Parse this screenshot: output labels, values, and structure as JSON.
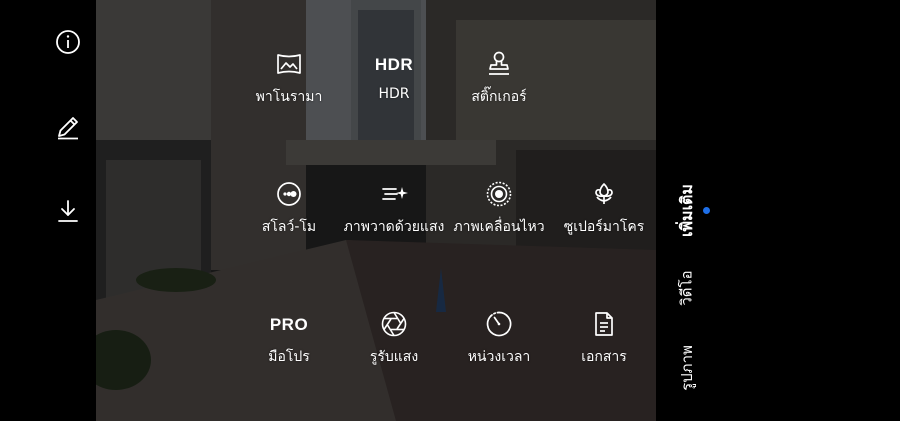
{
  "accent_color": "#1e6fe8",
  "left_controls": [
    {
      "name": "info-icon"
    },
    {
      "name": "edit-icon"
    },
    {
      "name": "download-icon"
    }
  ],
  "modes": {
    "row1": [
      {
        "icon": "panorama-icon",
        "label": "พาโนรามา"
      },
      {
        "icon_text": "HDR",
        "label": "HDR"
      },
      {
        "icon": "sticker-icon",
        "label": "สติ๊กเกอร์"
      }
    ],
    "row2": [
      {
        "icon": "slow-motion-icon",
        "label": "สโลว์-โม"
      },
      {
        "icon": "light-painting-icon",
        "label": "ภาพวาดด้วยแสง"
      },
      {
        "icon": "moving-picture-icon",
        "label": "ภาพเคลื่อนไหว"
      },
      {
        "icon": "super-macro-icon",
        "label": "ซูเปอร์มาโคร"
      }
    ],
    "row3": [
      {
        "icon_text": "PRO",
        "label": "มือโปร"
      },
      {
        "icon": "aperture-icon",
        "label": "รูรับแสง"
      },
      {
        "icon": "timelapse-icon",
        "label": "หน่วงเวลา"
      },
      {
        "icon": "document-icon",
        "label": "เอกสาร"
      }
    ]
  },
  "camera_tabs": [
    {
      "label": "เพิ่มเติม",
      "active": true
    },
    {
      "label": "วิดีโอ",
      "active": false
    },
    {
      "label": "รูปภาพ",
      "active": false
    }
  ]
}
